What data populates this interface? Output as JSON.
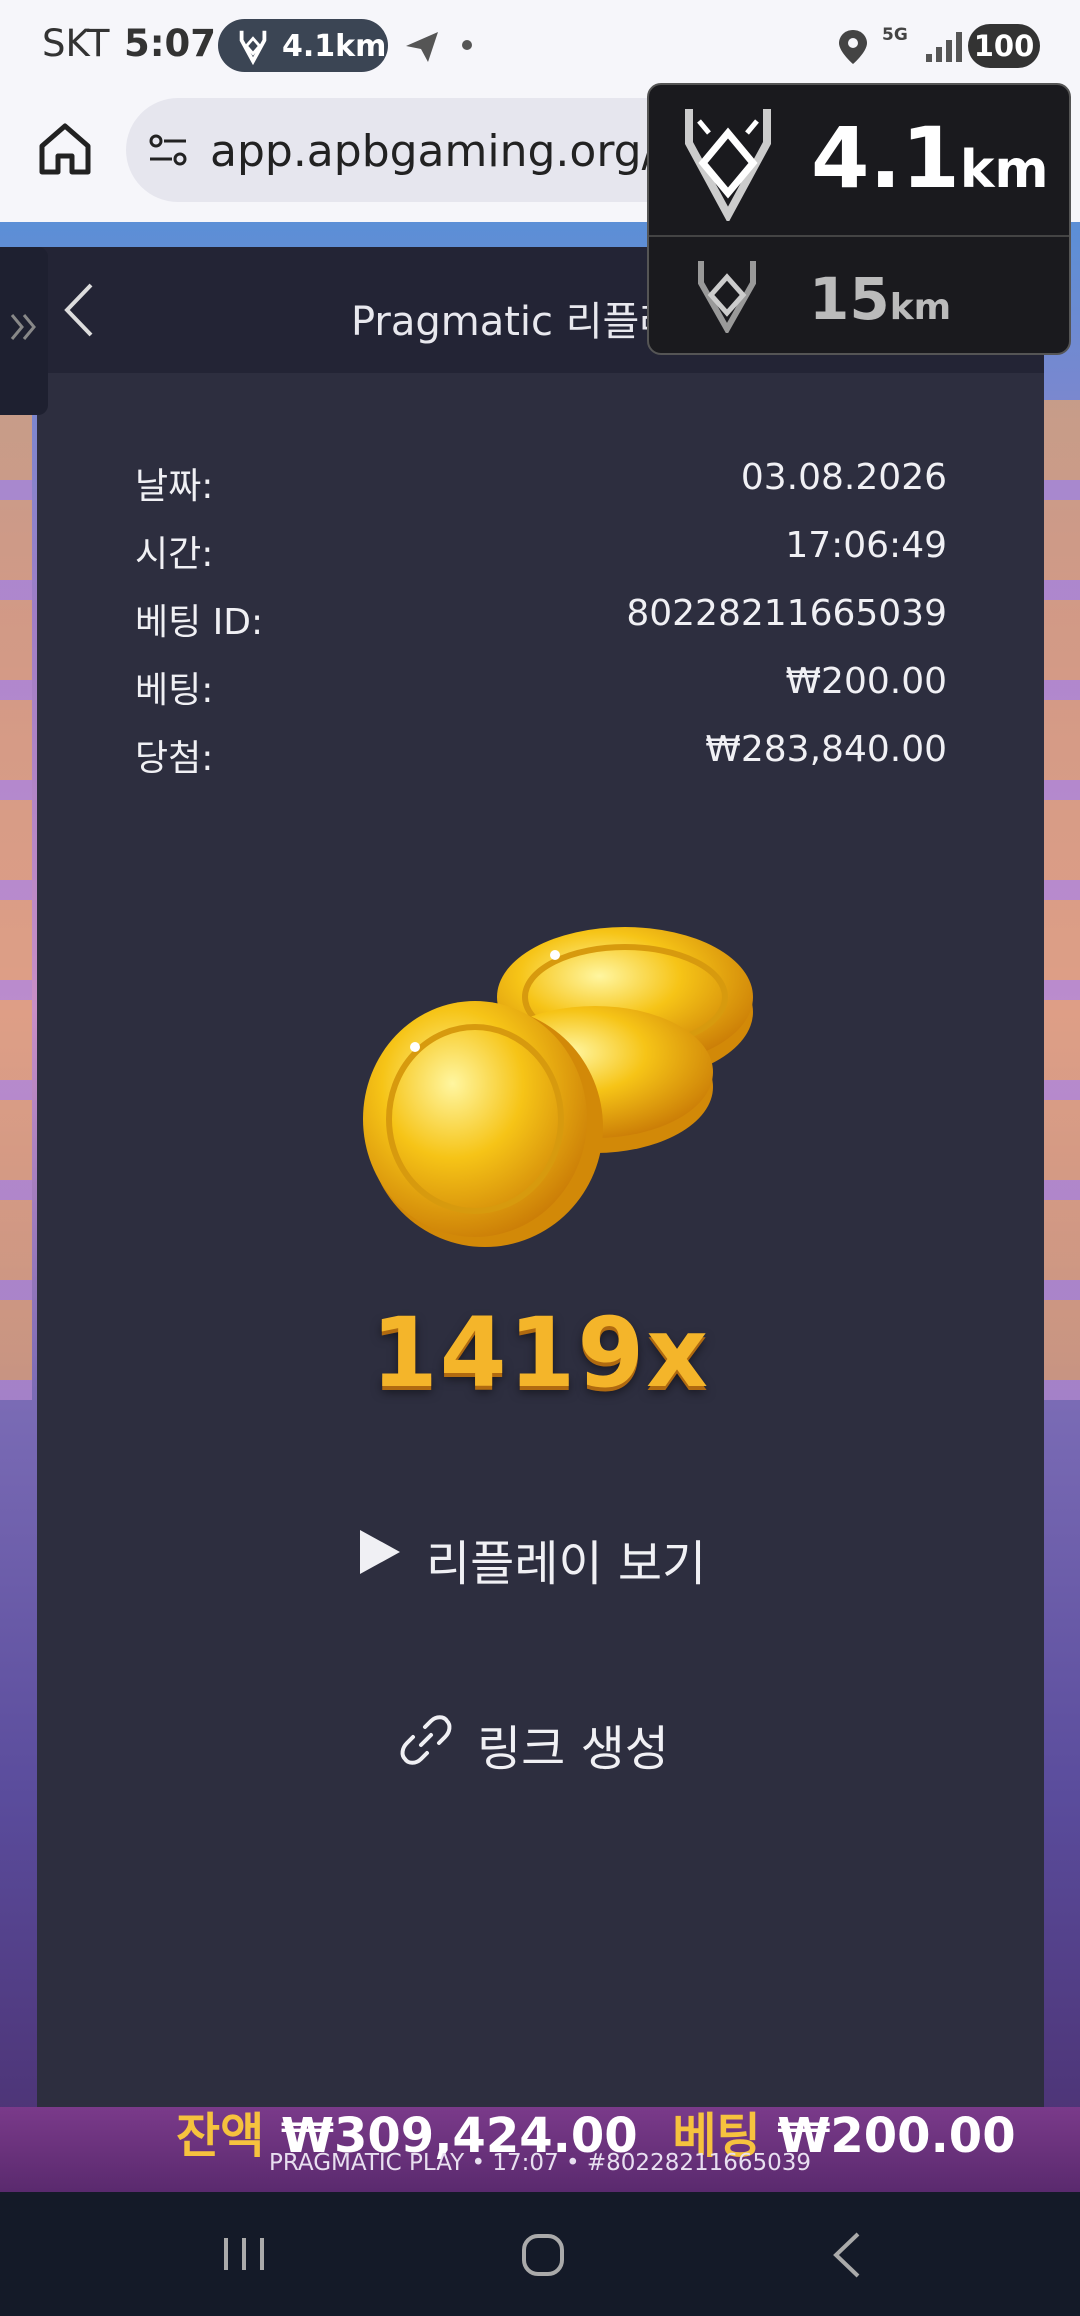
{
  "status_bar": {
    "carrier": "SKT",
    "time": "5:07",
    "nav_pill_distance": "4.1km",
    "network": "5G",
    "battery": "100"
  },
  "browser": {
    "url": "app.apbgaming.org/"
  },
  "modal": {
    "title": "Pragmatic 리플레이",
    "rows": [
      {
        "label": "날짜:",
        "value": "03.08.2026"
      },
      {
        "label": "시간:",
        "value": "17:06:49"
      },
      {
        "label": "베팅 ID:",
        "value": "80228211665039"
      },
      {
        "label": "베팅:",
        "value": "₩200.00"
      },
      {
        "label": "당첨:",
        "value": "₩283,840.00"
      }
    ],
    "multiplier": "1419x",
    "replay_label": "리플레이 보기",
    "link_label": "링크 생성"
  },
  "game_footer": {
    "balance_label": "잔액",
    "balance_value": "₩309,424.00",
    "bet_label": "베팅",
    "bet_value": "₩200.00",
    "provider_line": "PRAGMATIC PLAY • 17:07 • #80228211665039"
  },
  "nav_overlay": {
    "primary_distance": "4.1",
    "primary_unit": "km",
    "secondary_distance": "15",
    "secondary_unit": "km"
  },
  "colors": {
    "modal_bg": "#2d2e3f",
    "modal_header_bg": "#232435",
    "multiplier": "#f4b52a",
    "status_bar_bg": "#f6f6fa"
  }
}
